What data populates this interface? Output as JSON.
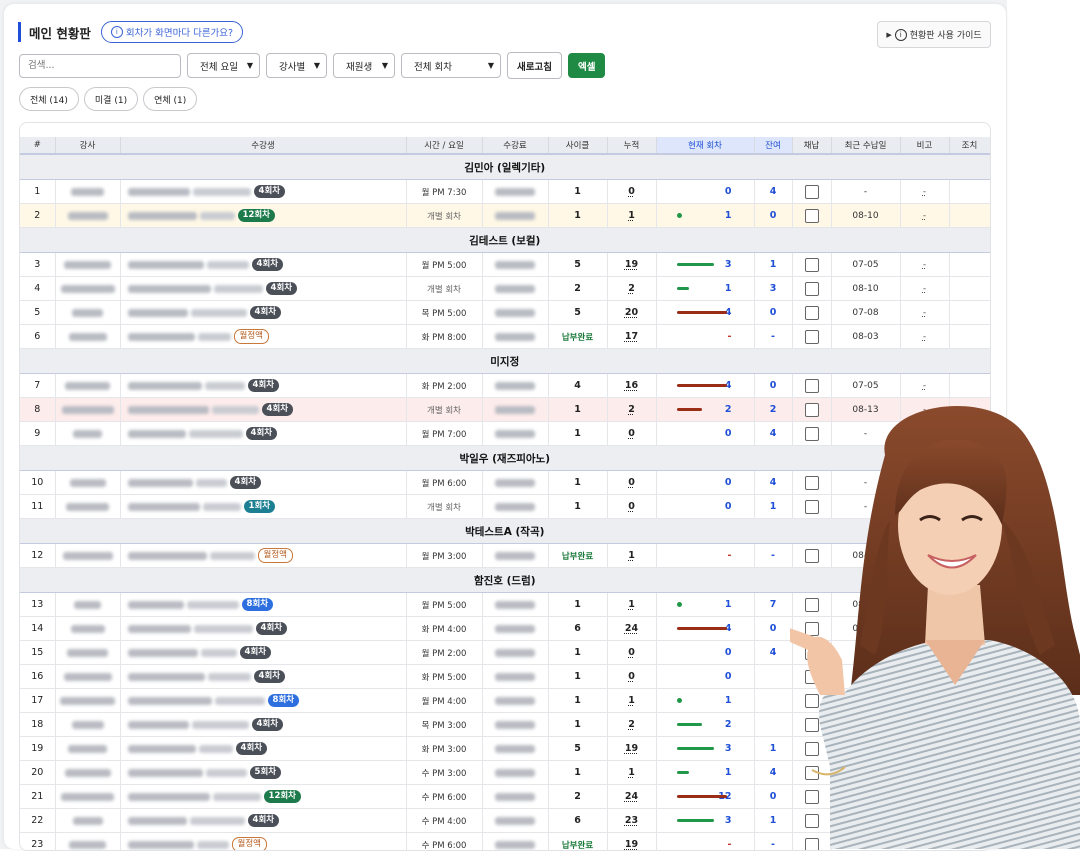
{
  "header": {
    "title": "메인 현황판",
    "help_pill": "회차가 화면마다 다른가요?",
    "guide_button": "현황판 사용 가이드"
  },
  "filters": {
    "search_placeholder": "검색...",
    "day_select": "전체 요일",
    "teacher_select": "강사별",
    "status_select": "재원생",
    "session_select": "전체 회차",
    "refresh": "새로고침",
    "excel": "엑셀"
  },
  "chips": [
    "전체 (14)",
    "미결 (1)",
    "연체 (1)"
  ],
  "columns": [
    "#",
    "강사",
    "수강생",
    "시간 / 요일",
    "수강료",
    "사이클",
    "누적",
    "현재 회차",
    "잔여",
    "채납",
    "최근 수납일",
    "비고",
    "조치"
  ],
  "groups": [
    {
      "name": "김민아 (일렉기타)",
      "rows": [
        {
          "n": "1",
          "badge": "4회차",
          "badge_style": "gray",
          "time": "월 PM 7:30",
          "cycle": "1",
          "cum": "0",
          "cur": "0",
          "bar": 0,
          "bar_color": "",
          "rem": "4",
          "date": "-",
          "state": ""
        },
        {
          "n": "2",
          "badge": "12회차",
          "badge_style": "green",
          "time": "개별 회차",
          "cycle": "1",
          "cum": "1",
          "cur": "1",
          "bar": 1,
          "bar_color": "dot",
          "rem": "0",
          "date": "08-10",
          "state": "y"
        }
      ]
    },
    {
      "name": "김테스트 (보컬)",
      "rows": [
        {
          "n": "3",
          "badge": "4회차",
          "badge_style": "gray",
          "time": "월 PM 5:00",
          "cycle": "5",
          "cum": "19",
          "cur": "3",
          "bar": 3,
          "bar_color": "g",
          "rem": "1",
          "date": "07-05",
          "state": ""
        },
        {
          "n": "4",
          "badge": "4회차",
          "badge_style": "gray",
          "time": "개별 회차",
          "cycle": "2",
          "cum": "2",
          "cur": "1",
          "bar": 1,
          "bar_color": "g",
          "rem": "3",
          "date": "08-10",
          "state": ""
        },
        {
          "n": "5",
          "badge": "4회차",
          "badge_style": "gray",
          "time": "목 PM 5:00",
          "cycle": "5",
          "cum": "20",
          "cur": "4",
          "bar": 4,
          "bar_color": "r",
          "rem": "0",
          "date": "07-08",
          "state": ""
        },
        {
          "n": "6",
          "badge": "월정액",
          "badge_style": "out",
          "time": "화 PM 8:00",
          "cycle": "납부완료",
          "cum": "17",
          "cur": "-",
          "bar": 0,
          "bar_color": "",
          "rem": "-",
          "date": "08-03",
          "state": ""
        }
      ]
    },
    {
      "name": "미지정",
      "rows": [
        {
          "n": "7",
          "badge": "4회차",
          "badge_style": "gray",
          "time": "화 PM 2:00",
          "cycle": "4",
          "cum": "16",
          "cur": "4",
          "bar": 4,
          "bar_color": "r",
          "rem": "0",
          "date": "07-05",
          "state": ""
        },
        {
          "n": "8",
          "badge": "4회차",
          "badge_style": "gray",
          "time": "개별 회차",
          "cycle": "1",
          "cum": "2",
          "cur": "2",
          "bar": 2,
          "bar_color": "r",
          "rem": "2",
          "date": "08-13",
          "state": "r"
        },
        {
          "n": "9",
          "badge": "4회차",
          "badge_style": "gray",
          "time": "월 PM 7:00",
          "cycle": "1",
          "cum": "0",
          "cur": "0",
          "bar": 0,
          "bar_color": "",
          "rem": "4",
          "date": "-",
          "state": ""
        }
      ]
    },
    {
      "name": "박일우 (재즈피아노)",
      "rows": [
        {
          "n": "10",
          "badge": "4회차",
          "badge_style": "gray",
          "time": "월 PM 6:00",
          "cycle": "1",
          "cum": "0",
          "cur": "0",
          "bar": 0,
          "bar_color": "",
          "rem": "4",
          "date": "-",
          "state": ""
        },
        {
          "n": "11",
          "badge": "1회차",
          "badge_style": "teal",
          "time": "개별 회차",
          "cycle": "1",
          "cum": "0",
          "cur": "0",
          "bar": 0,
          "bar_color": "",
          "rem": "1",
          "date": "-",
          "state": ""
        }
      ]
    },
    {
      "name": "박테스트A (작곡)",
      "rows": [
        {
          "n": "12",
          "badge": "월정액",
          "badge_style": "out",
          "time": "월 PM 3:00",
          "cycle": "납부완료",
          "cum": "1",
          "cur": "-",
          "bar": 0,
          "bar_color": "",
          "rem": "-",
          "date": "08-03",
          "state": ""
        }
      ]
    },
    {
      "name": "함진호 (드럼)",
      "rows": [
        {
          "n": "13",
          "badge": "8회차",
          "badge_style": "blue",
          "time": "월 PM 5:00",
          "cycle": "1",
          "cum": "1",
          "cur": "1",
          "bar": 1,
          "bar_color": "dot",
          "rem": "7",
          "date": "08-02",
          "state": ""
        },
        {
          "n": "14",
          "badge": "4회차",
          "badge_style": "gray",
          "time": "화 PM 4:00",
          "cycle": "6",
          "cum": "24",
          "cur": "4",
          "bar": 4,
          "bar_color": "r",
          "rem": "0",
          "date": "07-25",
          "state": ""
        },
        {
          "n": "15",
          "badge": "4회차",
          "badge_style": "gray",
          "time": "월 PM 2:00",
          "cycle": "1",
          "cum": "0",
          "cur": "0",
          "bar": 0,
          "bar_color": "",
          "rem": "4",
          "date": "-",
          "state": ""
        },
        {
          "n": "16",
          "badge": "4회차",
          "badge_style": "gray",
          "time": "화 PM 5:00",
          "cycle": "1",
          "cum": "0",
          "cur": "0",
          "bar": 0,
          "bar_color": "",
          "rem": "",
          "date": "",
          "state": ""
        },
        {
          "n": "17",
          "badge": "8회차",
          "badge_style": "blue",
          "time": "월 PM 4:00",
          "cycle": "1",
          "cum": "1",
          "cur": "1",
          "bar": 1,
          "bar_color": "dot",
          "rem": "",
          "date": "",
          "state": ""
        },
        {
          "n": "18",
          "badge": "4회차",
          "badge_style": "gray",
          "time": "목 PM 3:00",
          "cycle": "1",
          "cum": "2",
          "cur": "2",
          "bar": 2,
          "bar_color": "g",
          "rem": "",
          "date": "",
          "state": ""
        },
        {
          "n": "19",
          "badge": "4회차",
          "badge_style": "gray",
          "time": "화 PM 3:00",
          "cycle": "5",
          "cum": "19",
          "cur": "3",
          "bar": 3,
          "bar_color": "g",
          "rem": "1",
          "date": "",
          "state": ""
        },
        {
          "n": "20",
          "badge": "5회차",
          "badge_style": "gray",
          "time": "수 PM 3:00",
          "cycle": "1",
          "cum": "1",
          "cur": "1",
          "bar": 1,
          "bar_color": "g",
          "rem": "4",
          "date": "",
          "state": ""
        },
        {
          "n": "21",
          "badge": "12회차",
          "badge_style": "green",
          "time": "수 PM 6:00",
          "cycle": "2",
          "cum": "24",
          "cur": "12",
          "bar": 12,
          "bar_color": "r",
          "rem": "0",
          "date": "",
          "state": ""
        },
        {
          "n": "22",
          "badge": "4회차",
          "badge_style": "gray",
          "time": "수 PM 4:00",
          "cycle": "6",
          "cum": "23",
          "cur": "3",
          "bar": 3,
          "bar_color": "g",
          "rem": "1",
          "date": "",
          "state": ""
        },
        {
          "n": "23",
          "badge": "월정액",
          "badge_style": "out",
          "time": "수 PM 6:00",
          "cycle": "납부완료",
          "cum": "19",
          "cur": "-",
          "bar": 0,
          "bar_color": "",
          "rem": "-",
          "date": "",
          "state": ""
        }
      ]
    }
  ],
  "colors": {
    "accent": "#1f4fd6",
    "excel": "#1f8a43",
    "progress_ok": "#21974a",
    "progress_full": "#9a2d16"
  }
}
